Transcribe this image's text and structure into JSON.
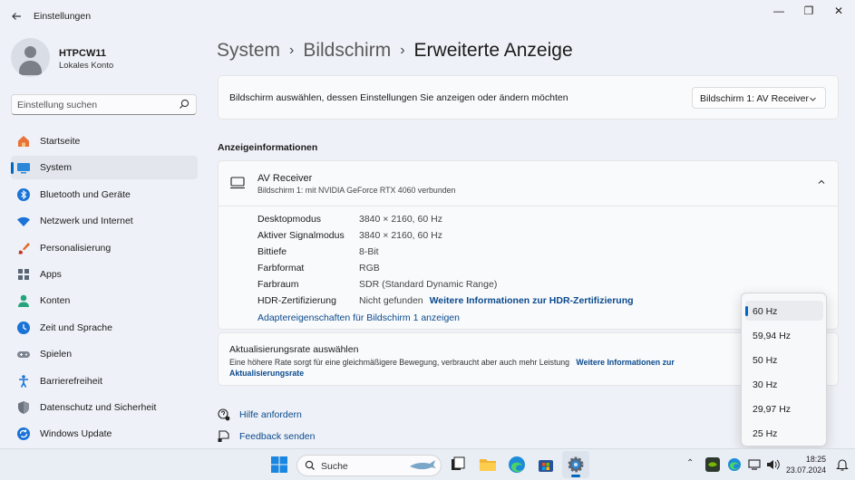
{
  "window": {
    "title": "Einstellungen",
    "back_icon": "back-arrow-icon",
    "minimize": "—",
    "maximize": "❐",
    "close": "✕"
  },
  "user": {
    "name": "HTPCW11",
    "account": "Lokales Konto"
  },
  "search": {
    "placeholder": "Einstellung suchen"
  },
  "sidebar": {
    "items": [
      {
        "label": "Startseite",
        "icon": "home-icon"
      },
      {
        "label": "System",
        "icon": "system-monitor-icon",
        "active": true
      },
      {
        "label": "Bluetooth und Geräte",
        "icon": "bluetooth-icon"
      },
      {
        "label": "Netzwerk und Internet",
        "icon": "wifi-icon"
      },
      {
        "label": "Personalisierung",
        "icon": "paintbrush-icon"
      },
      {
        "label": "Apps",
        "icon": "apps-icon"
      },
      {
        "label": "Konten",
        "icon": "account-icon"
      },
      {
        "label": "Zeit und Sprache",
        "icon": "clock-globe-icon"
      },
      {
        "label": "Spielen",
        "icon": "gamepad-icon"
      },
      {
        "label": "Barrierefreiheit",
        "icon": "accessibility-icon"
      },
      {
        "label": "Datenschutz und Sicherheit",
        "icon": "shield-icon"
      },
      {
        "label": "Windows Update",
        "icon": "update-icon"
      }
    ]
  },
  "breadcrumb": {
    "items": [
      "System",
      "Bildschirm",
      "Erweiterte Anzeige"
    ],
    "separator": "›"
  },
  "display_select": {
    "label": "Bildschirm auswählen, dessen Einstellungen Sie anzeigen oder ändern möchten",
    "value": "Bildschirm 1: AV Receiver"
  },
  "display_info": {
    "section_title": "Anzeigeinformationen",
    "name": "AV Receiver",
    "subtitle": "Bildschirm 1: mit NVIDIA GeForce RTX 4060 verbunden",
    "rows": [
      {
        "key": "Desktopmodus",
        "value": "3840 × 2160, 60 Hz"
      },
      {
        "key": "Aktiver Signalmodus",
        "value": "3840 × 2160, 60 Hz"
      },
      {
        "key": "Bittiefe",
        "value": "8-Bit"
      },
      {
        "key": "Farbformat",
        "value": "RGB"
      },
      {
        "key": "Farbraum",
        "value": "SDR (Standard Dynamic Range)"
      },
      {
        "key": "HDR-Zertifizierung",
        "value": "Nicht gefunden",
        "link": "Weitere Informationen zur HDR-Zertifizierung"
      }
    ],
    "adapter_link": "Adaptereigenschaften für Bildschirm 1 anzeigen"
  },
  "refresh_rate": {
    "title": "Aktualisierungsrate auswählen",
    "description": "Eine höhere Rate sorgt für eine gleichmäßigere Bewegung, verbraucht aber auch mehr Leistung",
    "link": "Weitere Informationen zur Aktualisierungsrate",
    "options": [
      "60 Hz",
      "59,94 Hz",
      "50 Hz",
      "30 Hz",
      "29,97 Hz",
      "25 Hz"
    ],
    "selected": "60 Hz"
  },
  "help": {
    "get_help": "Hilfe anfordern",
    "feedback": "Feedback senden"
  },
  "taskbar": {
    "search_label": "Suche",
    "time": "18:25",
    "date": "23.07.2024"
  },
  "colors": {
    "accent": "#0067c0",
    "link": "#0b4a8c",
    "background": "#eef1f7",
    "card": "#f9fafc"
  }
}
